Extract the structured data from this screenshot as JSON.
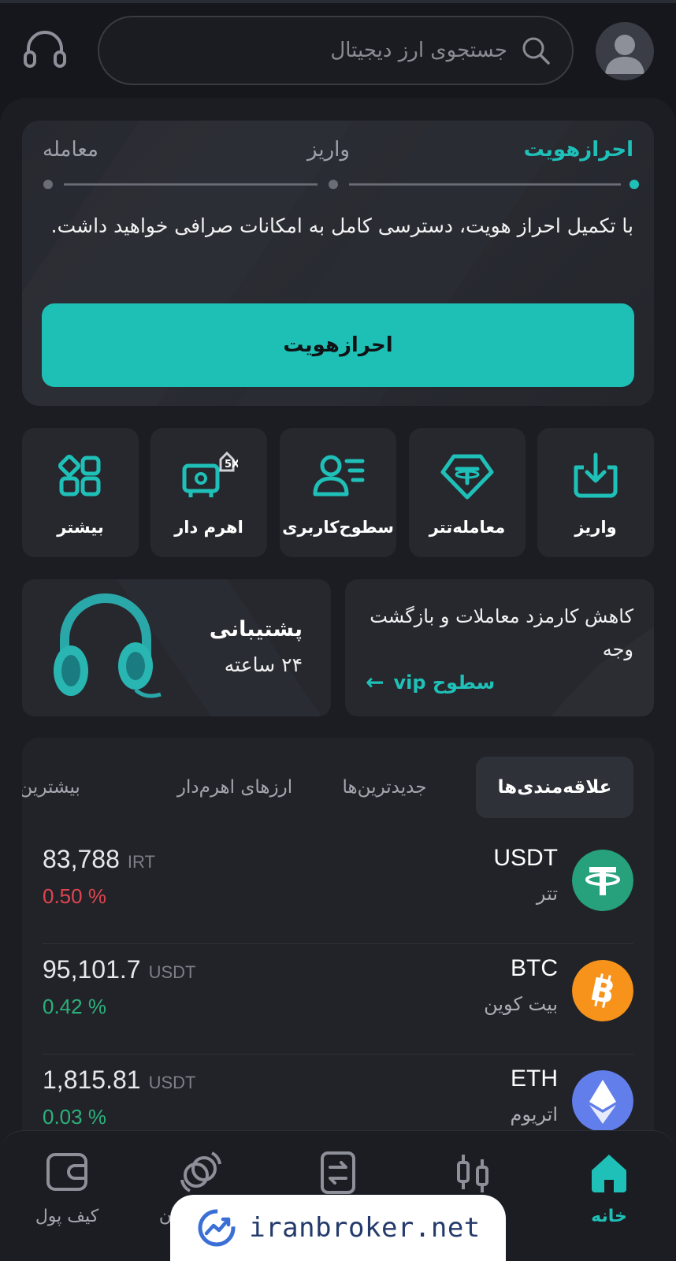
{
  "header": {
    "search_placeholder": "جستجوی ارز دیجیتال"
  },
  "kyc": {
    "steps": [
      "احرازهویت",
      "واریز",
      "معامله"
    ],
    "description": "با تکمیل احراز هویت، دسترسی کامل به امکانات صرافی خواهید داشت.",
    "button_label": "احرازهویت"
  },
  "quick_actions": [
    {
      "label": "واریز",
      "icon": "deposit-icon"
    },
    {
      "label": "معامله‌تتر",
      "icon": "tether-icon"
    },
    {
      "label": "سطوح‌کاربری",
      "icon": "user-levels-icon"
    },
    {
      "label": "اهرم دار",
      "icon": "leverage-icon"
    },
    {
      "label": "بیشتر",
      "icon": "more-icon"
    }
  ],
  "promos": {
    "vip_text": "کاهش کارمزد معاملات و بازگشت وجه",
    "vip_link": "سطوح vip",
    "support_title": "پشتیبانی",
    "support_sub": "۲۴ ساعته"
  },
  "market": {
    "tabs": [
      "علاقه‌مندی‌ها",
      "جدیدترین‌ها",
      "ارزهای اهرم‌دار",
      "بیشترین ر"
    ],
    "rows": [
      {
        "symbol": "USDT",
        "name": "تتر",
        "price": "83,788",
        "unit": "IRT",
        "change": "0.50 %",
        "change_color": "#e0454f",
        "icon_color": "#26a17b"
      },
      {
        "symbol": "BTC",
        "name": "بیت کوین",
        "price": "95,101.7",
        "unit": "USDT",
        "change": "0.42 %",
        "change_color": "#2ab27b",
        "icon_color": "#f7931a"
      },
      {
        "symbol": "ETH",
        "name": "اتریوم",
        "price": "1,815.81",
        "unit": "USDT",
        "change": "0.03 %",
        "change_color": "#2ab27b",
        "icon_color": "#627eea"
      }
    ]
  },
  "bottom_nav": {
    "items": [
      "خانه",
      "",
      "",
      "",
      "کیف پول"
    ],
    "partial_label": "ن"
  },
  "watermark": "iranbroker.net",
  "colors": {
    "accent": "#1ec0b6",
    "background": "#16171c",
    "card": "#26282e"
  }
}
